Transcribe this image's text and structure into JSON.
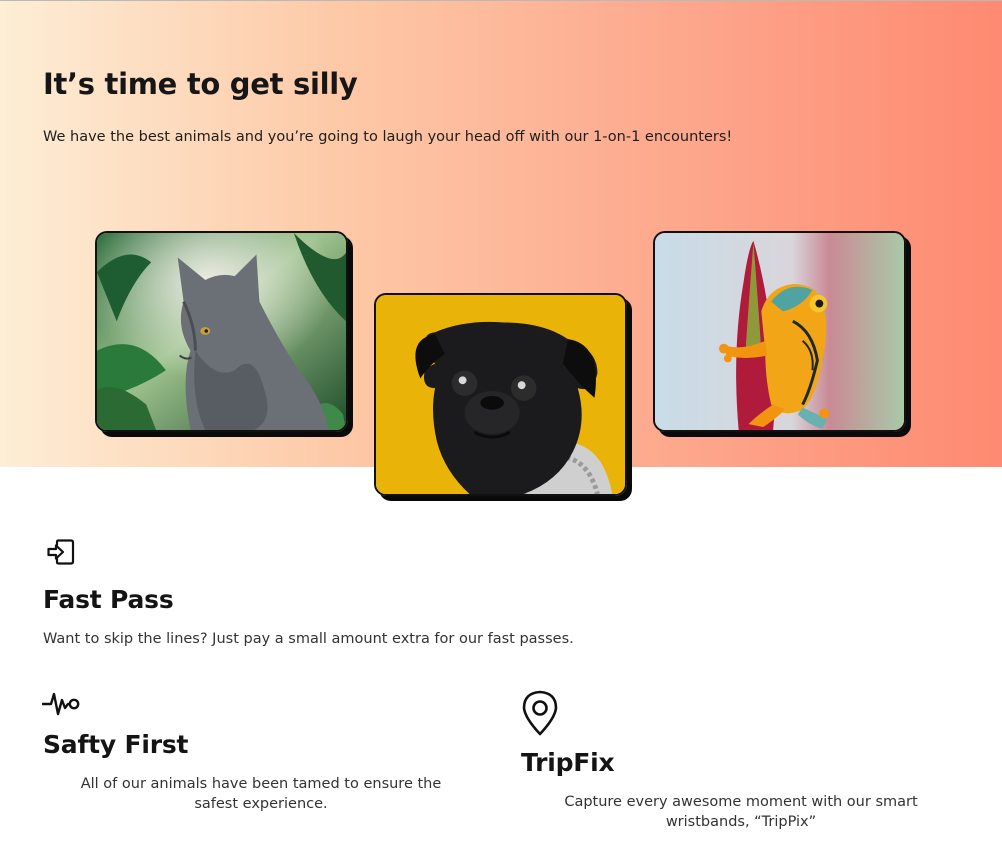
{
  "hero": {
    "title": "It’s time to get silly",
    "subtitle": "We have the best animals and you’re going to laugh your head off with our 1-on-1 encounters!",
    "gradient": [
      "#fdeed6",
      "#fd8a71"
    ]
  },
  "gallery": [
    {
      "icon": "cat-photo",
      "subject": "cat"
    },
    {
      "icon": "pug-photo",
      "subject": "pug"
    },
    {
      "icon": "frog-photo",
      "subject": "frog"
    }
  ],
  "features": {
    "fast_pass": {
      "icon": "login-arrow-icon",
      "title": "Fast Pass",
      "text": "Want to skip the lines? Just pay a small amount extra for our fast passes."
    },
    "safety_first": {
      "icon": "heartbeat-icon",
      "title": "Safty First",
      "text": "All of our animals have been tamed to ensure the safest experience."
    },
    "tripfix": {
      "icon": "map-pin-icon",
      "title": "TripFix",
      "text": "Capture every awesome moment with our smart wristbands, “TripPix”"
    }
  }
}
